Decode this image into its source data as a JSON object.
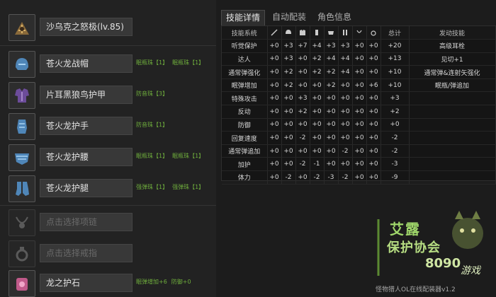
{
  "equipment": [
    {
      "slot": "weapon",
      "icon": "weapon-icon",
      "name": "沙乌克之怒极(lv.85)",
      "decos": [],
      "empty": false
    },
    {
      "slot": "head",
      "icon": "helmet-icon",
      "name": "苍火龙战帽",
      "decos": [
        "眠瓶珠【1】",
        "眠瓶珠【1】"
      ],
      "empty": false
    },
    {
      "slot": "chest",
      "icon": "chest-armor-icon",
      "name": "片耳黑狼鸟护甲",
      "decos": [
        "防音珠【3】"
      ],
      "empty": false
    },
    {
      "slot": "arms",
      "icon": "gauntlet-icon",
      "name": "苍火龙护手",
      "decos": [
        "防音珠【1】"
      ],
      "empty": false
    },
    {
      "slot": "waist",
      "icon": "waist-armor-icon",
      "name": "苍火龙护腰",
      "decos": [
        "眠瓶珠【1】",
        "眠瓶珠【1】"
      ],
      "empty": false
    },
    {
      "slot": "legs",
      "icon": "leg-armor-icon",
      "name": "苍火龙护腿",
      "decos": [
        "强弹珠【1】",
        "强弹珠【1】"
      ],
      "empty": false
    },
    {
      "slot": "necklace",
      "icon": "necklace-icon",
      "name": "点击选择项链",
      "decos": [],
      "empty": true
    },
    {
      "slot": "ring",
      "icon": "ring-icon",
      "name": "点击选择戒指",
      "decos": [],
      "empty": true
    },
    {
      "slot": "talisman",
      "icon": "talisman-icon",
      "name": "龙之护石",
      "decos": [
        "眠弹增加+6",
        "防御+0"
      ],
      "empty": false
    }
  ],
  "tabs": [
    {
      "label": "技能详情",
      "active": true
    },
    {
      "label": "自动配装",
      "active": false
    },
    {
      "label": "角色信息",
      "active": false
    }
  ],
  "skill_table": {
    "header_name": "技能系统",
    "header_total": "总计",
    "header_active": "发动技能",
    "column_icons": [
      "weapon-icon",
      "helmet-icon",
      "chest-armor-icon",
      "gauntlet-icon",
      "waist-armor-icon",
      "leg-armor-icon",
      "necklace-icon",
      "ring-icon"
    ],
    "rows": [
      {
        "name": "听觉保护",
        "values": [
          "+0",
          "+3",
          "+7",
          "+4",
          "+3",
          "+3",
          "+0",
          "+0"
        ],
        "total": "+20",
        "active": "高级耳栓"
      },
      {
        "name": "达人",
        "values": [
          "+0",
          "+3",
          "+0",
          "+2",
          "+4",
          "+4",
          "+0",
          "+0"
        ],
        "total": "+13",
        "active": "见切+1"
      },
      {
        "name": "通常弹强化",
        "values": [
          "+0",
          "+2",
          "+0",
          "+2",
          "+2",
          "+4",
          "+0",
          "+0"
        ],
        "total": "+10",
        "active": "通常弹&连射矢强化"
      },
      {
        "name": "眠弹增加",
        "values": [
          "+0",
          "+2",
          "+0",
          "+0",
          "+2",
          "+0",
          "+0",
          "+6"
        ],
        "total": "+10",
        "active": "眠瓶/弹追加"
      },
      {
        "name": "特殊攻击",
        "values": [
          "+0",
          "+0",
          "+3",
          "+0",
          "+0",
          "+0",
          "+0",
          "+0"
        ],
        "total": "+3",
        "active": ""
      },
      {
        "name": "反动",
        "values": [
          "+0",
          "+0",
          "+2",
          "+0",
          "+0",
          "+0",
          "+0",
          "+0"
        ],
        "total": "+2",
        "active": ""
      },
      {
        "name": "防御",
        "values": [
          "+0",
          "+0",
          "+0",
          "+0",
          "+0",
          "+0",
          "+0",
          "+0"
        ],
        "total": "+0",
        "active": ""
      },
      {
        "name": "回复速度",
        "values": [
          "+0",
          "+0",
          "-2",
          "+0",
          "+0",
          "+0",
          "+0",
          "+0"
        ],
        "total": "-2",
        "active": ""
      },
      {
        "name": "通常弹追加",
        "values": [
          "+0",
          "+0",
          "+0",
          "+0",
          "+0",
          "-2",
          "+0",
          "+0"
        ],
        "total": "-2",
        "active": ""
      },
      {
        "name": "加护",
        "values": [
          "+0",
          "+0",
          "-2",
          "-1",
          "+0",
          "+0",
          "+0",
          "+0"
        ],
        "total": "-3",
        "active": ""
      },
      {
        "name": "体力",
        "values": [
          "+0",
          "-2",
          "+0",
          "-2",
          "-3",
          "-2",
          "+0",
          "+0"
        ],
        "total": "-9",
        "active": ""
      }
    ]
  },
  "logo": {
    "line1": "艾露",
    "line2": "保护协会",
    "number": "8090",
    "site": "游戏",
    "subtitle": "怪物猎人OL在线配装器v1.2"
  },
  "colors": {
    "deco_green": "#6fae3c",
    "logo_green": "#9fd66a"
  }
}
